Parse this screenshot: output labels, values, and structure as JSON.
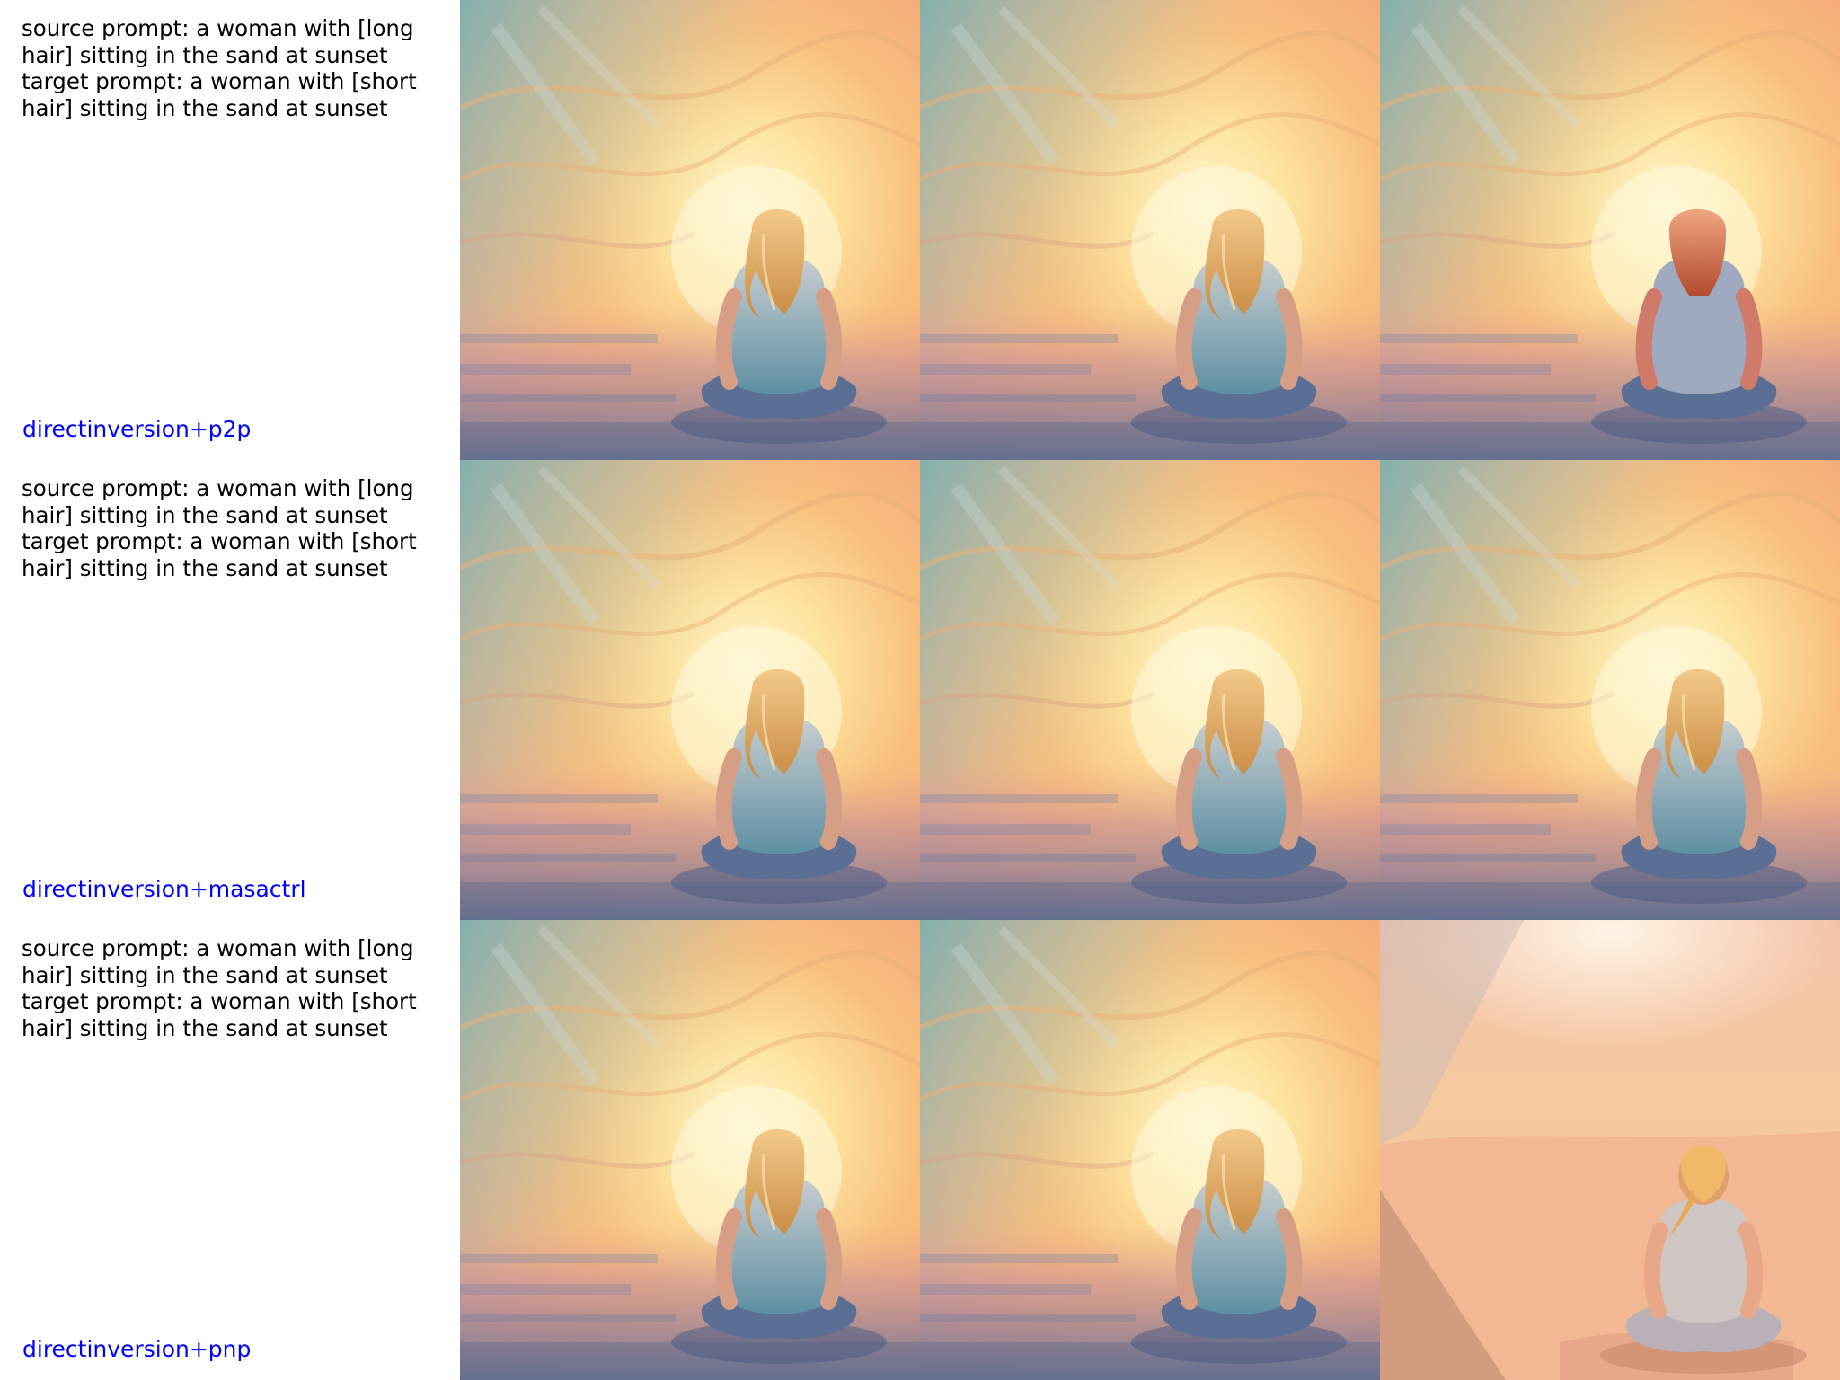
{
  "rows": [
    {
      "source_prompt": "source prompt: a woman with [long hair] sitting in the sand at sunset",
      "target_prompt": "target prompt: a woman with [short hair] sitting in the sand at sunset",
      "method": "directinversion+p2p"
    },
    {
      "source_prompt": "source prompt: a woman with [long hair] sitting in the sand at sunset",
      "target_prompt": "target prompt: a woman with [short hair] sitting in the sand at sunset",
      "method": "directinversion+masactrl"
    },
    {
      "source_prompt": "source prompt: a woman with [long hair] sitting in the sand at sunset",
      "target_prompt": "target prompt: a woman with [short hair] sitting in the sand at sunset",
      "method": "directinversion+pnp"
    }
  ],
  "colors": {
    "method_label": "#0000ff",
    "prompt_text": "#000000"
  }
}
